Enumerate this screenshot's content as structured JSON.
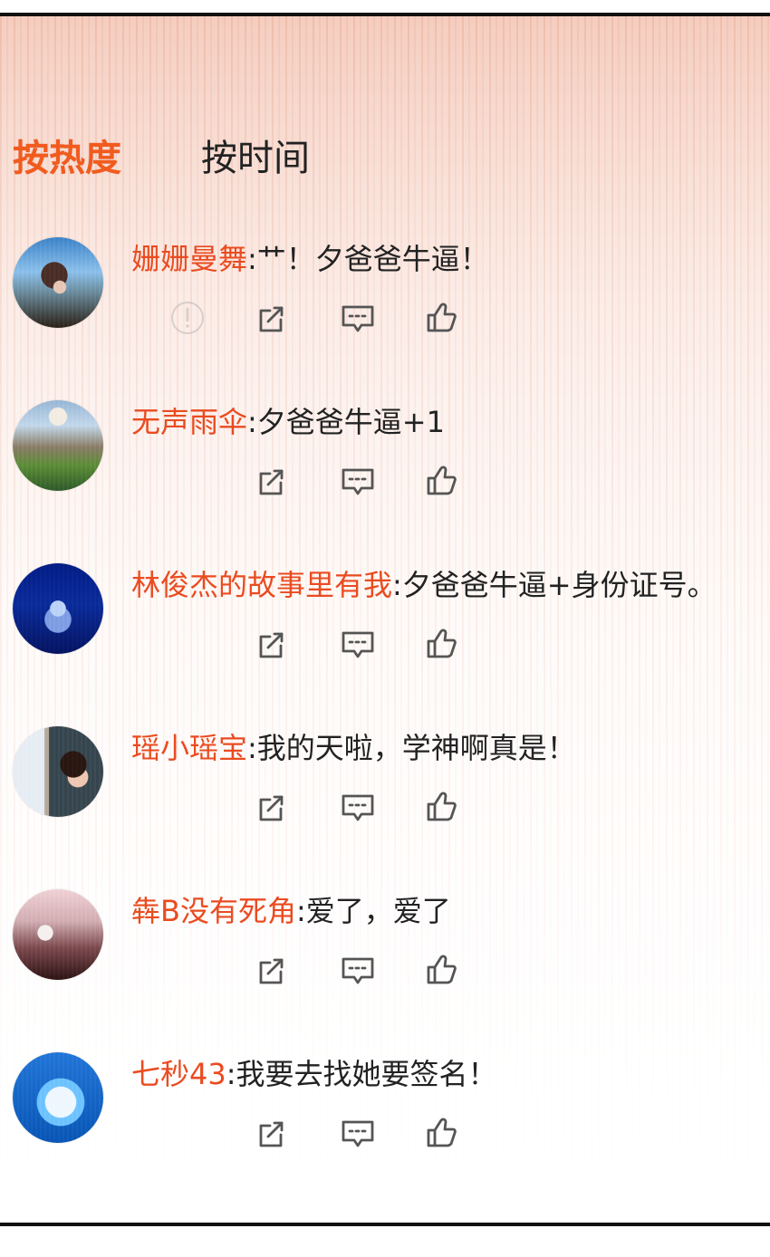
{
  "tabs": [
    {
      "label": "按热度",
      "active": true
    },
    {
      "label": "按时间",
      "active": false
    }
  ],
  "comments": [
    {
      "username": "姗姗曼舞",
      "separator": ":",
      "text": "艹！夕爸爸牛逼！",
      "avatar": "avatar-photo",
      "actions": [
        "report-icon",
        "share-icon",
        "comment-icon",
        "like-icon"
      ]
    },
    {
      "username": "无声雨伞",
      "separator": ":",
      "text": "夕爸爸牛逼+1",
      "avatar": "avatar-photo",
      "actions": [
        "share-icon",
        "comment-icon",
        "like-icon"
      ]
    },
    {
      "username": "林俊杰的故事里有我",
      "separator": ":",
      "text": "夕爸爸牛逼+身份证号。",
      "avatar": "avatar-photo",
      "actions": [
        "share-icon",
        "comment-icon",
        "like-icon"
      ]
    },
    {
      "username": "瑶小瑶宝",
      "separator": ":",
      "text": "我的天啦，学神啊真是！",
      "avatar": "avatar-photo",
      "actions": [
        "share-icon",
        "comment-icon",
        "like-icon"
      ]
    },
    {
      "username": "犇B没有死角",
      "separator": ":",
      "text": "爱了，爱了",
      "avatar": "avatar-photo",
      "actions": [
        "share-icon",
        "comment-icon",
        "like-icon"
      ]
    },
    {
      "username": "七秒43",
      "separator": ":",
      "text": "我要去找她要签名！",
      "avatar": "avatar-photo",
      "actions": [
        "share-icon",
        "comment-icon",
        "like-icon"
      ]
    }
  ],
  "colors": {
    "active_tab": "#f25b1e",
    "username": "#ea4b20",
    "text": "#222222",
    "icon": "#555555"
  }
}
